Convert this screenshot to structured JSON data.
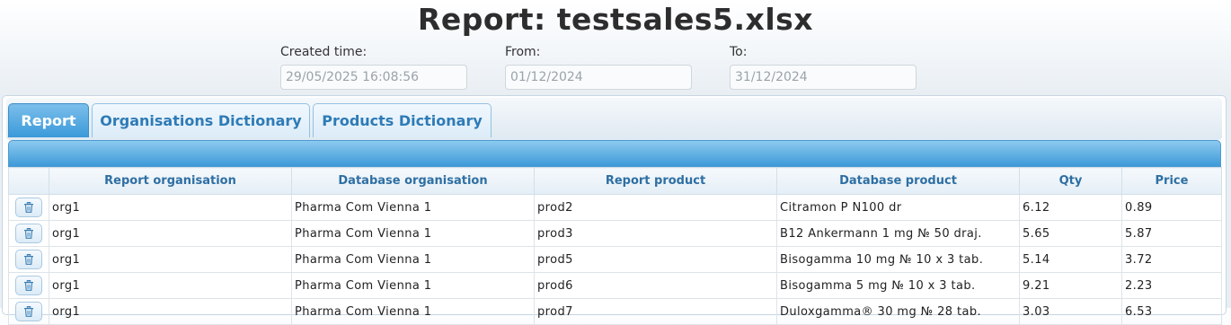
{
  "header": {
    "title": "Report: testsales5.xlsx",
    "created": {
      "label": "Created time:",
      "value": "29/05/2025 16:08:56"
    },
    "from": {
      "label": "From:",
      "value": "01/12/2024"
    },
    "to": {
      "label": "To:",
      "value": "31/12/2024"
    }
  },
  "tabs": [
    {
      "label": "Report",
      "active": true
    },
    {
      "label": "Organisations Dictionary",
      "active": false
    },
    {
      "label": "Products Dictionary",
      "active": false
    }
  ],
  "grid": {
    "columns": [
      "",
      "Report organisation",
      "Database organisation",
      "Report product",
      "Database product",
      "Qty",
      "Price"
    ],
    "rows": [
      [
        "org1",
        "Pharma Com Vienna 1",
        "prod2",
        "Citramon P N100 dr",
        "6.12",
        "0.89"
      ],
      [
        "org1",
        "Pharma Com Vienna 1",
        "prod3",
        "B12 Ankermann 1 mg № 50 draj.",
        "5.65",
        "5.87"
      ],
      [
        "org1",
        "Pharma Com Vienna 1",
        "prod5",
        "Bisogamma 10 mg № 10 x 3 tab.",
        "5.14",
        "3.72"
      ],
      [
        "org1",
        "Pharma Com Vienna 1",
        "prod6",
        "Bisogamma 5 mg № 10 x 3 tab.",
        "9.21",
        "2.23"
      ],
      [
        "org1",
        "Pharma Com Vienna 1",
        "prod7",
        "Duloxgamma® 30 mg № 28 tab.",
        "3.03",
        "6.53"
      ]
    ]
  },
  "colors": {
    "accent": "#3a9ad9",
    "header_text": "#2e6fa3"
  }
}
